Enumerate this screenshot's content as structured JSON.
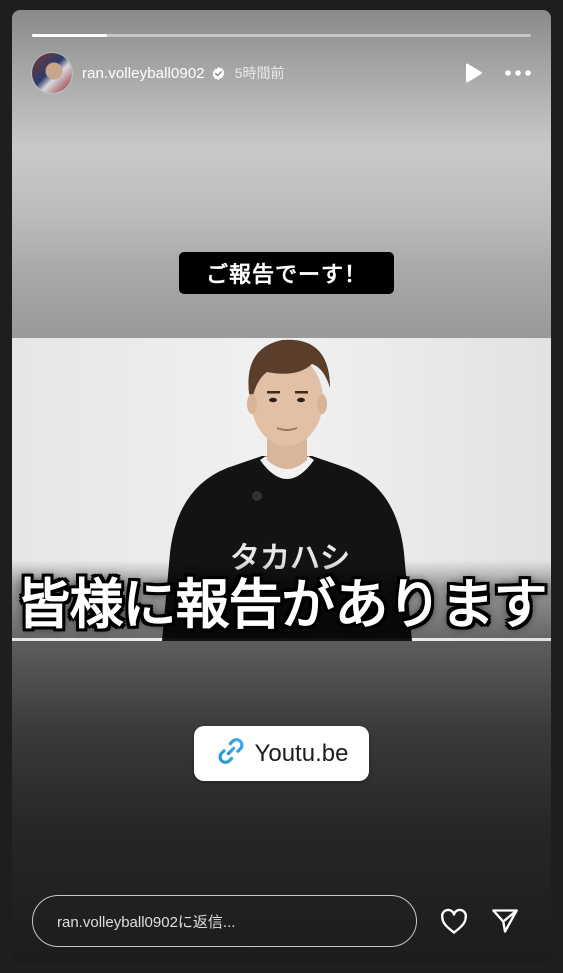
{
  "story": {
    "progress_fraction": 0.15,
    "account": {
      "username": "ran.volleyball0902",
      "verified": true,
      "posted_ago": "5時間前"
    },
    "header_icons": [
      "play-icon",
      "more-options-icon"
    ],
    "caption_badge": "ご報告でーす！",
    "video_thumbnail": {
      "title_overlay": "皆様に報告があります"
    },
    "link_sticker": {
      "icon": "link-icon",
      "label": "Youtu.be"
    },
    "reply": {
      "placeholder": "ran.volleyball0902に返信..."
    },
    "footer_icons": [
      "heart-icon",
      "send-icon"
    ]
  }
}
